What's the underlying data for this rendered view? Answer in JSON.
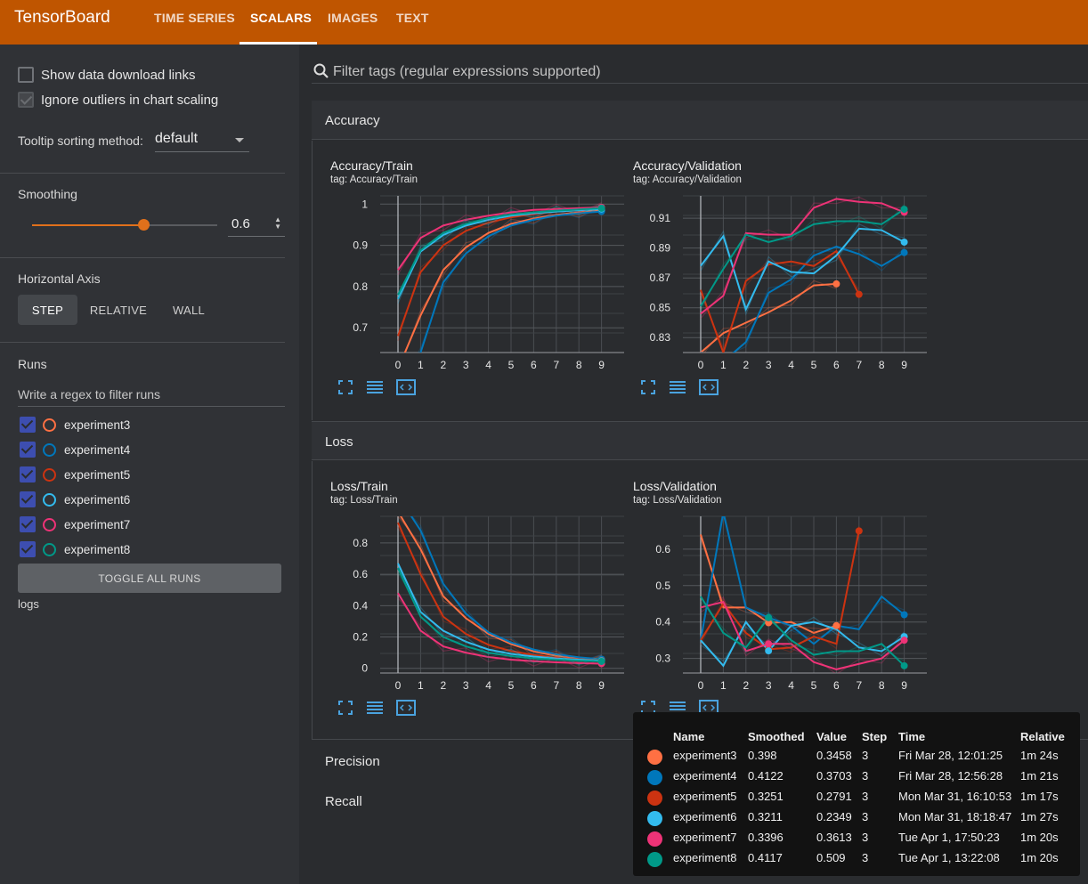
{
  "app": {
    "title": "TensorBoard",
    "tabs": [
      "TIME SERIES",
      "SCALARS",
      "IMAGES",
      "TEXT"
    ],
    "active_tab": "SCALARS"
  },
  "sidebar": {
    "show_download": "Show data download links",
    "ignore_outliers": "Ignore outliers in chart scaling",
    "tooltip_sort_label": "Tooltip sorting method:",
    "tooltip_sort_value": "default",
    "smoothing_label": "Smoothing",
    "smoothing_value": "0.6",
    "smoothing_fraction": 0.6,
    "horizontal_axis_label": "Horizontal Axis",
    "axis_options": [
      "STEP",
      "RELATIVE",
      "WALL"
    ],
    "axis_selected": "STEP",
    "runs_label": "Runs",
    "runs_filter_placeholder": "Write a regex to filter runs",
    "runs": [
      {
        "name": "experiment3",
        "color": "#ff7043",
        "checked": true
      },
      {
        "name": "experiment4",
        "color": "#0077bb",
        "checked": true
      },
      {
        "name": "experiment5",
        "color": "#cc3311",
        "checked": true
      },
      {
        "name": "experiment6",
        "color": "#33bbee",
        "checked": true
      },
      {
        "name": "experiment7",
        "color": "#ee3377",
        "checked": true
      },
      {
        "name": "experiment8",
        "color": "#009988",
        "checked": true
      }
    ],
    "toggle_all": "TOGGLE ALL RUNS",
    "logdir": "logs"
  },
  "main": {
    "filter_placeholder": "Filter tags (regular expressions supported)",
    "sections": {
      "accuracy": "Accuracy",
      "loss": "Loss",
      "precision": "Precision",
      "recall": "Recall"
    },
    "charts": {
      "acc_train": {
        "title": "Accuracy/Train",
        "tag": "tag: Accuracy/Train"
      },
      "acc_val": {
        "title": "Accuracy/Validation",
        "tag": "tag: Accuracy/Validation"
      },
      "loss_train": {
        "title": "Loss/Train",
        "tag": "tag: Loss/Train"
      },
      "loss_val": {
        "title": "Loss/Validation",
        "tag": "tag: Loss/Validation"
      }
    }
  },
  "tooltip": {
    "headers": [
      "Name",
      "Smoothed",
      "Value",
      "Step",
      "Time",
      "Relative"
    ],
    "rows": [
      {
        "name": "experiment3",
        "smoothed": "0.398",
        "value": "0.3458",
        "step": "3",
        "time": "Fri Mar 28, 12:01:25",
        "relative": "1m 24s",
        "color": "#ff7043"
      },
      {
        "name": "experiment4",
        "smoothed": "0.4122",
        "value": "0.3703",
        "step": "3",
        "time": "Fri Mar 28, 12:56:28",
        "relative": "1m 21s",
        "color": "#0077bb"
      },
      {
        "name": "experiment5",
        "smoothed": "0.3251",
        "value": "0.2791",
        "step": "3",
        "time": "Mon Mar 31, 16:10:53",
        "relative": "1m 17s",
        "color": "#cc3311"
      },
      {
        "name": "experiment6",
        "smoothed": "0.3211",
        "value": "0.2349",
        "step": "3",
        "time": "Mon Mar 31, 18:18:47",
        "relative": "1m 27s",
        "color": "#33bbee"
      },
      {
        "name": "experiment7",
        "smoothed": "0.3396",
        "value": "0.3613",
        "step": "3",
        "time": "Tue Apr 1, 17:50:23",
        "relative": "1m 20s",
        "color": "#ee3377"
      },
      {
        "name": "experiment8",
        "smoothed": "0.4117",
        "value": "0.509",
        "step": "3",
        "time": "Tue Apr 1, 13:22:08",
        "relative": "1m 20s",
        "color": "#009988"
      }
    ]
  },
  "chart_data": [
    {
      "type": "line",
      "title": "Accuracy/Train",
      "x": [
        0,
        1,
        2,
        3,
        4,
        5,
        6,
        7,
        8,
        9
      ],
      "ylim": [
        0.64,
        1.02
      ],
      "yticks": [
        "1",
        "0.9",
        "0.8",
        "0.7"
      ],
      "ytick_values": [
        1,
        0.9,
        0.8,
        0.7
      ],
      "series": [
        {
          "name": "experiment3",
          "color": "#ff7043",
          "values": [
            0.6,
            0.73,
            0.84,
            0.895,
            0.93,
            0.952,
            0.965,
            0.974,
            0.98,
            0.985
          ]
        },
        {
          "name": "experiment4",
          "color": "#0077bb",
          "values": [
            0.55,
            0.64,
            0.81,
            0.88,
            0.922,
            0.948,
            0.962,
            0.972,
            0.978,
            0.982
          ]
        },
        {
          "name": "experiment5",
          "color": "#cc3311",
          "values": [
            0.68,
            0.835,
            0.9,
            0.935,
            0.955,
            0.968,
            0.976,
            0.982,
            0.986,
            0.99
          ]
        },
        {
          "name": "experiment6",
          "color": "#33bbee",
          "values": [
            0.77,
            0.885,
            0.925,
            0.948,
            0.962,
            0.972,
            0.978,
            0.982,
            0.985,
            0.988
          ]
        },
        {
          "name": "experiment7",
          "color": "#ee3377",
          "values": [
            0.84,
            0.918,
            0.948,
            0.962,
            0.972,
            0.98,
            0.986,
            0.988,
            0.99,
            0.992
          ]
        },
        {
          "name": "experiment8",
          "color": "#009988",
          "values": [
            0.78,
            0.888,
            0.93,
            0.952,
            0.966,
            0.975,
            0.98,
            0.984,
            0.987,
            0.99
          ]
        }
      ]
    },
    {
      "type": "line",
      "title": "Accuracy/Validation",
      "x": [
        0,
        1,
        2,
        3,
        4,
        5,
        6,
        7,
        8,
        9
      ],
      "ylim": [
        0.82,
        0.925
      ],
      "yticks": [
        "0.91",
        "0.89",
        "0.87",
        "0.85",
        "0.83"
      ],
      "ytick_values": [
        0.91,
        0.89,
        0.87,
        0.85,
        0.83
      ],
      "series": [
        {
          "name": "experiment3",
          "color": "#ff7043",
          "values": [
            0.82,
            0.833,
            0.84,
            0.847,
            0.855,
            0.865,
            0.866
          ]
        },
        {
          "name": "experiment4",
          "color": "#0077bb",
          "values": [
            0.82,
            0.814,
            0.827,
            0.86,
            0.869,
            0.885,
            0.891,
            0.886,
            0.878,
            0.887
          ]
        },
        {
          "name": "experiment5",
          "color": "#cc3311",
          "values": [
            0.862,
            0.82,
            0.868,
            0.879,
            0.881,
            0.878,
            0.888,
            0.859
          ]
        },
        {
          "name": "experiment6",
          "color": "#33bbee",
          "values": [
            0.878,
            0.898,
            0.849,
            0.881,
            0.874,
            0.873,
            0.885,
            0.903,
            0.902,
            0.894
          ]
        },
        {
          "name": "experiment7",
          "color": "#ee3377",
          "values": [
            0.846,
            0.858,
            0.9,
            0.899,
            0.899,
            0.917,
            0.923,
            0.921,
            0.92,
            0.914
          ]
        },
        {
          "name": "experiment8",
          "color": "#009988",
          "values": [
            0.851,
            0.876,
            0.899,
            0.894,
            0.898,
            0.906,
            0.908,
            0.908,
            0.906,
            0.916
          ]
        }
      ]
    },
    {
      "type": "line",
      "title": "Loss/Train",
      "x": [
        0,
        1,
        2,
        3,
        4,
        5,
        6,
        7,
        8,
        9
      ],
      "ylim": [
        -0.03,
        0.97
      ],
      "yticks": [
        "0.8",
        "0.6",
        "0.4",
        "0.2",
        "0"
      ],
      "ytick_values": [
        0.8,
        0.6,
        0.4,
        0.2,
        0
      ],
      "series": [
        {
          "name": "experiment3",
          "color": "#ff7043",
          "values": [
            1.0,
            0.76,
            0.46,
            0.32,
            0.22,
            0.155,
            0.108,
            0.08,
            0.065,
            0.055
          ]
        },
        {
          "name": "experiment4",
          "color": "#0077bb",
          "values": [
            1.1,
            0.88,
            0.54,
            0.35,
            0.23,
            0.165,
            0.12,
            0.09,
            0.07,
            0.058
          ]
        },
        {
          "name": "experiment5",
          "color": "#cc3311",
          "values": [
            0.93,
            0.6,
            0.33,
            0.22,
            0.15,
            0.11,
            0.085,
            0.068,
            0.058,
            0.05
          ]
        },
        {
          "name": "experiment6",
          "color": "#33bbee",
          "values": [
            0.67,
            0.36,
            0.24,
            0.17,
            0.12,
            0.092,
            0.075,
            0.063,
            0.055,
            0.048
          ]
        },
        {
          "name": "experiment7",
          "color": "#ee3377",
          "values": [
            0.48,
            0.24,
            0.14,
            0.1,
            0.072,
            0.055,
            0.045,
            0.038,
            0.033,
            0.03
          ]
        },
        {
          "name": "experiment8",
          "color": "#009988",
          "values": [
            0.64,
            0.33,
            0.2,
            0.14,
            0.1,
            0.078,
            0.064,
            0.055,
            0.049,
            0.044
          ]
        }
      ]
    },
    {
      "type": "line",
      "title": "Loss/Validation",
      "x": [
        0,
        1,
        2,
        3,
        4,
        5,
        6,
        7,
        8,
        9
      ],
      "ylim": [
        0.26,
        0.69
      ],
      "yticks": [
        "0.6",
        "0.5",
        "0.4",
        "0.3"
      ],
      "ytick_values": [
        0.6,
        0.5,
        0.4,
        0.3
      ],
      "series": [
        {
          "name": "experiment3",
          "color": "#ff7043",
          "values": [
            0.64,
            0.44,
            0.44,
            0.398,
            0.4,
            0.37,
            0.39
          ]
        },
        {
          "name": "experiment4",
          "color": "#0077bb",
          "values": [
            0.35,
            0.7,
            0.44,
            0.412,
            0.39,
            0.34,
            0.39,
            0.38,
            0.47,
            0.42
          ]
        },
        {
          "name": "experiment5",
          "color": "#cc3311",
          "values": [
            0.35,
            0.45,
            0.37,
            0.325,
            0.33,
            0.36,
            0.34,
            0.65
          ]
        },
        {
          "name": "experiment6",
          "color": "#33bbee",
          "values": [
            0.35,
            0.28,
            0.4,
            0.321,
            0.39,
            0.4,
            0.38,
            0.33,
            0.32,
            0.36
          ]
        },
        {
          "name": "experiment7",
          "color": "#ee3377",
          "values": [
            0.44,
            0.455,
            0.32,
            0.34,
            0.34,
            0.29,
            0.27,
            0.285,
            0.3,
            0.35
          ]
        },
        {
          "name": "experiment8",
          "color": "#009988",
          "values": [
            0.47,
            0.37,
            0.33,
            0.412,
            0.35,
            0.31,
            0.32,
            0.32,
            0.34,
            0.28
          ]
        }
      ]
    }
  ]
}
